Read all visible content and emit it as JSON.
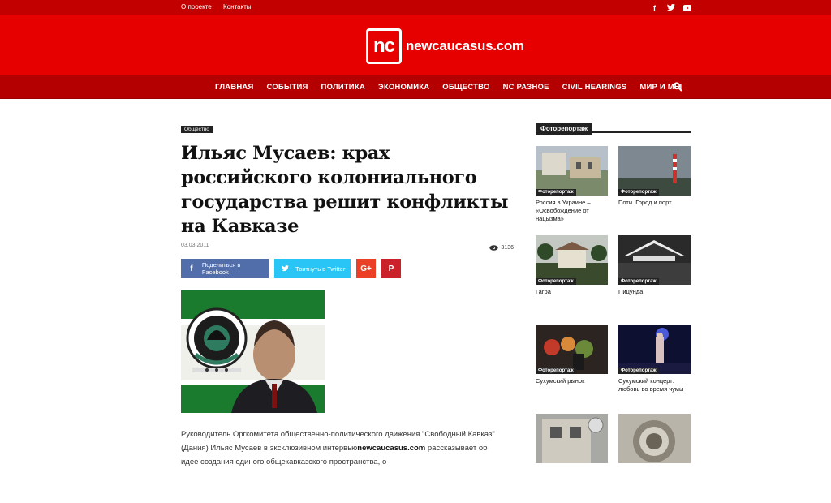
{
  "topbar": {
    "links": [
      "О проекте",
      "Контакты"
    ],
    "social": [
      "facebook-icon",
      "twitter-icon",
      "youtube-icon"
    ]
  },
  "logo": {
    "mark": "nc",
    "name": "newcaucasus.com"
  },
  "nav": {
    "items": [
      "ГЛАВНАЯ",
      "СОБЫТИЯ",
      "ПОЛИТИКА",
      "ЭКОНОМИКА",
      "ОБЩЕСТВО",
      "NC РАЗНОЕ",
      "CIVIL HEARINGS",
      "МИР И МЫ"
    ]
  },
  "article": {
    "category": "Общество",
    "title": "Ильяс Мусаев: крах российского колониального государства решит конфликты на Кавказе",
    "date": "03.03.2011",
    "views": "3136",
    "share": {
      "facebook": "Поделиться в Facebook",
      "twitter": "Твитнуть в Twitter",
      "gplus": "G+",
      "pinterest": "P"
    },
    "text_1": "Руководитель Оргкомитета общественно-политического движения \"Свободный Кавказ\" (Дания) Ильяс Мусаев в эксклюзивном интервью",
    "text_site": "newcaucasus.com",
    "text_2": "рассказывает об идее создания единого общекавказского пространства, о"
  },
  "sidebar": {
    "title": "Фоторепортаж",
    "cards": [
      {
        "tag": "Фоторепортаж",
        "title": "Россия в Украине – «Освобождение от нацызма»"
      },
      {
        "tag": "Фоторепортаж",
        "title": "Поти. Город и порт"
      },
      {
        "tag": "Фоторепортаж",
        "title": "Гагра"
      },
      {
        "tag": "Фоторепортаж",
        "title": "Пицунда"
      },
      {
        "tag": "Фоторепортаж",
        "title": "Сухумский рынок"
      },
      {
        "tag": "Фоторепортаж",
        "title": "Сухумский концерт: любовь во время чумы"
      },
      {
        "tag": "",
        "title": ""
      },
      {
        "tag": "",
        "title": ""
      }
    ]
  }
}
